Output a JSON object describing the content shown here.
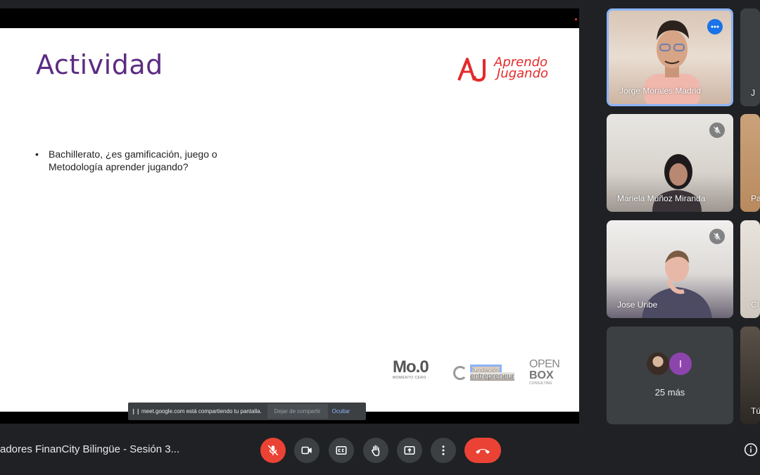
{
  "slide": {
    "title": "Actividad",
    "logo_line1": "Aprendo",
    "logo_line2": "Jugando",
    "bullet_bullet": "•",
    "bullet_text": "Bachillerato, ¿es gamificación, juego o Metodología aprender jugando?",
    "footer": {
      "mo0_big": "Mo.0",
      "mo0_small": "MOMENTO CERO ·",
      "fund_line1": "fundación",
      "fund_line2": "entrepreneur",
      "openbox_line1": "OPEN",
      "openbox_line2": "BOX",
      "openbox_line3": "CONSULTING"
    }
  },
  "share_bar": {
    "pause_icon": "❙❙",
    "message": "meet.google.com está compartiendo tu pantalla.",
    "stop_label": "Dejar de compartir",
    "hide_label": "Ocultar"
  },
  "participants": [
    {
      "name": "Jorge Morales Madrid",
      "state": "speaking"
    },
    {
      "name": "Mariela Muñoz Miranda",
      "state": "muted"
    },
    {
      "name": "Jose Uribe",
      "state": "muted"
    }
  ],
  "participants_partial": [
    {
      "name": "J"
    },
    {
      "name": "Pa"
    },
    {
      "name": "Cl"
    },
    {
      "name": "Tú"
    }
  ],
  "more": {
    "avatar_letter": "I",
    "label": "25 más"
  },
  "bottom_bar": {
    "meeting_name": "adores FinanCity Bilingüe - Sesión 3...",
    "icons": [
      "mic-off-icon",
      "camera-icon",
      "captions-icon",
      "raise-hand-icon",
      "present-icon",
      "more-options-icon",
      "hang-up-icon",
      "info-icon"
    ]
  },
  "colors": {
    "background": "#202124",
    "slide_title": "#5b2c82",
    "logo": "#e32b2b",
    "danger": "#ea4335",
    "active_border": "#8ab4f8",
    "accent_blue": "#1a73e8"
  }
}
